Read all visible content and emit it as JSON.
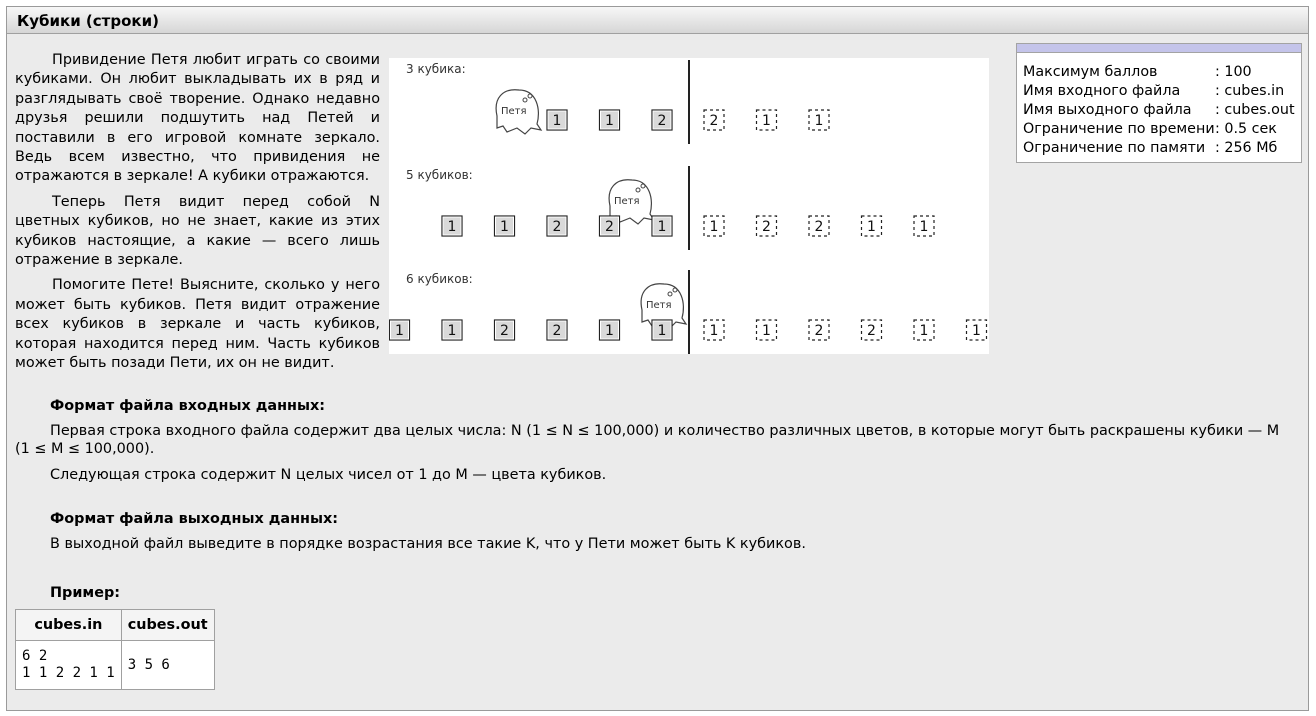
{
  "title": "Кубики (строки)",
  "statement": [
    "Привидение Петя любит играть со своими кубиками. Он любит выкладывать их в ряд и разглядывать своё творение. Однако недавно друзья решили подшутить над Петей и поставили в его игровой комнате зеркало. Ведь всем известно, что привидения не отражаются в зеркале! А кубики отражаются.",
    "Теперь Петя видит перед собой N цветных кубиков, но не знает, какие из этих кубиков настоящие, а какие — всего лишь отражение в зеркале.",
    "Помогите Пете! Выясните, сколько у него может быть кубиков. Петя видит отражение всех кубиков в зеркале и часть кубиков, которая находится перед ним. Часть кубиков может быть позади Пети, их он не видит."
  ],
  "figure": {
    "ghost_label": "Петя",
    "rows": [
      {
        "label": "3 кубика:",
        "real": [
          "1",
          "1",
          "2"
        ],
        "mirror": [
          "2",
          "1",
          "1"
        ]
      },
      {
        "label": "5 кубиков:",
        "real": [
          "1",
          "1",
          "2",
          "2",
          "1"
        ],
        "mirror": [
          "1",
          "2",
          "2",
          "1",
          "1"
        ]
      },
      {
        "label": "6 кубиков:",
        "real": [
          "1",
          "1",
          "2",
          "2",
          "1",
          "1"
        ],
        "mirror": [
          "1",
          "1",
          "2",
          "2",
          "1",
          "1"
        ]
      }
    ]
  },
  "limits": {
    "rows": [
      {
        "key": "Максимум баллов",
        "value": ": 100"
      },
      {
        "key": "Имя входного файла",
        "value": ": cubes.in"
      },
      {
        "key": "Имя выходного файла",
        "value": ": cubes.out"
      },
      {
        "key": "Ограничение по времени",
        "value": ": 0.5 сек"
      },
      {
        "key": "Ограничение по памяти",
        "value": ": 256 Мб"
      }
    ]
  },
  "input_format": {
    "heading": "Формат файла входных данных:",
    "line1": "Первая строка входного файла содержит два целых числа: N (1 ≤ N ≤ 100,000) и количество различных цветов, в которые могут быть раскрашены кубики — M",
    "line1b": "(1 ≤ M ≤ 100,000).",
    "line2": "Следующая строка содержит N целых чисел от 1 до M — цвета кубиков."
  },
  "output_format": {
    "heading": "Формат файла выходных данных:",
    "line1": "В выходной файл выведите в порядке возрастания все такие K, что у Пети может быть K кубиков."
  },
  "example": {
    "heading": "Пример:",
    "col_in": "cubes.in",
    "col_out": "cubes.out",
    "input": "6 2\n1 1 2 2 1 1",
    "output": "3 5 6"
  }
}
